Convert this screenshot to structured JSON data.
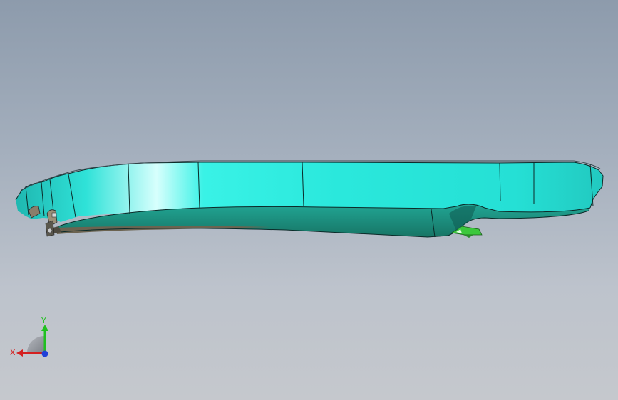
{
  "viewport": {
    "background_top": "#8d9bac",
    "background_bottom": "#c5c8cd"
  },
  "model": {
    "top_face_color": "#27e8dc",
    "bottom_face_color": "#1e9586",
    "underside_color": "#6b6350",
    "bracket_color": "#3cc83c"
  },
  "triad": {
    "x_label": "X",
    "y_label": "Y",
    "x_color": "#d42020",
    "y_color": "#20c020",
    "z_color": "#2040d8"
  }
}
